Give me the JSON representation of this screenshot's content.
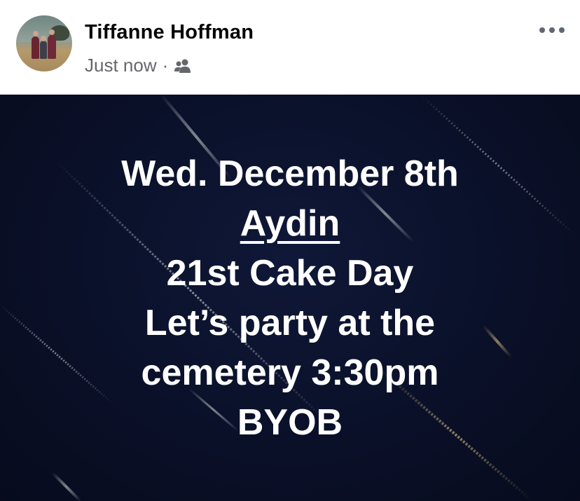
{
  "post": {
    "author_name": "Tiffanne Hoffman",
    "timestamp": "Just now",
    "separator": "·",
    "audience_icon": "friends-icon",
    "more_icon": "more-options-icon"
  },
  "image_text": {
    "line1": "Wed. December 8th",
    "line2": "Aydin",
    "line3": "21st Cake Day",
    "line4": "Let’s party at the",
    "line5": "cemetery 3:30pm",
    "line6": "BYOB"
  },
  "colors": {
    "background": "#0a1028",
    "text": "#ffffff",
    "author": "#050505",
    "meta": "#65676b"
  }
}
